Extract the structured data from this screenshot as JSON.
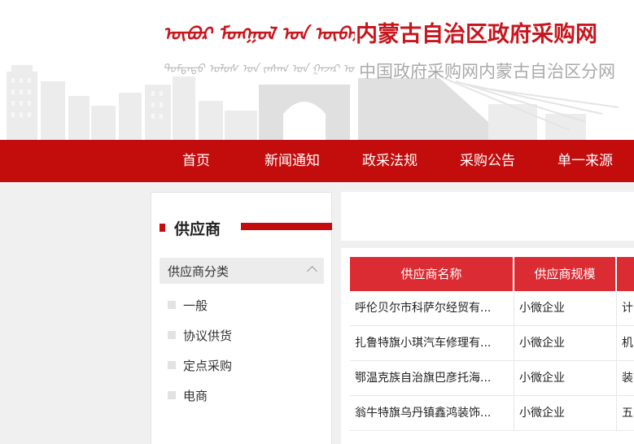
{
  "header": {
    "title": "内蒙古自治区政府采购网",
    "subtitle": "中国政府采购网内蒙古自治区分网",
    "mongolian_title": "ᠥᠪᠥᠷ ᠮᠣᠩᠭᠣᠯ ᠤᠨ ᠥᠪᠡᠷᠲᠡᠭᠡᠨ ᠵᠠᠰᠠᠬᠤ",
    "mongolian_subtitle": "ᠳᠤᠮᠳᠠᠳᠤ ᠤᠯᠤᠰ ᠤᠨ ᠵᠠᠰᠠᠭ ᠤᠨ ᠭᠠᠵᠠᠷ ᠤᠨ ᠬᠤᠳᠠᠯᠳᠤᠨ ᠠᠪᠬᠤ"
  },
  "nav": {
    "items": [
      {
        "label": "首页"
      },
      {
        "label": "新闻通知"
      },
      {
        "label": "政采法规"
      },
      {
        "label": "采购公告"
      },
      {
        "label": "单一来源"
      }
    ]
  },
  "sidebar": {
    "title": "供应商",
    "category_label": "供应商分类",
    "category_icon": "chevron-up-icon",
    "items": [
      {
        "label": "一般"
      },
      {
        "label": "协议供货"
      },
      {
        "label": "定点采购"
      },
      {
        "label": "电商"
      }
    ]
  },
  "table": {
    "headers": [
      "供应商名称",
      "供应商规模"
    ],
    "rows": [
      {
        "name": "呼伦贝尔市科萨尔经贸有...",
        "scale": "小微企业",
        "extra": "计"
      },
      {
        "name": "扎鲁特旗小琪汽车修理有...",
        "scale": "小微企业",
        "extra": "机"
      },
      {
        "name": "鄂温克族自治旗巴彦托海...",
        "scale": "小微企业",
        "extra": "装"
      },
      {
        "name": "翁牛特旗乌丹镇鑫鸿装饰...",
        "scale": "小微企业",
        "extra": "五"
      }
    ]
  },
  "colors": {
    "brand_red": "#c30d0d",
    "table_header_red": "#dc2c33"
  }
}
